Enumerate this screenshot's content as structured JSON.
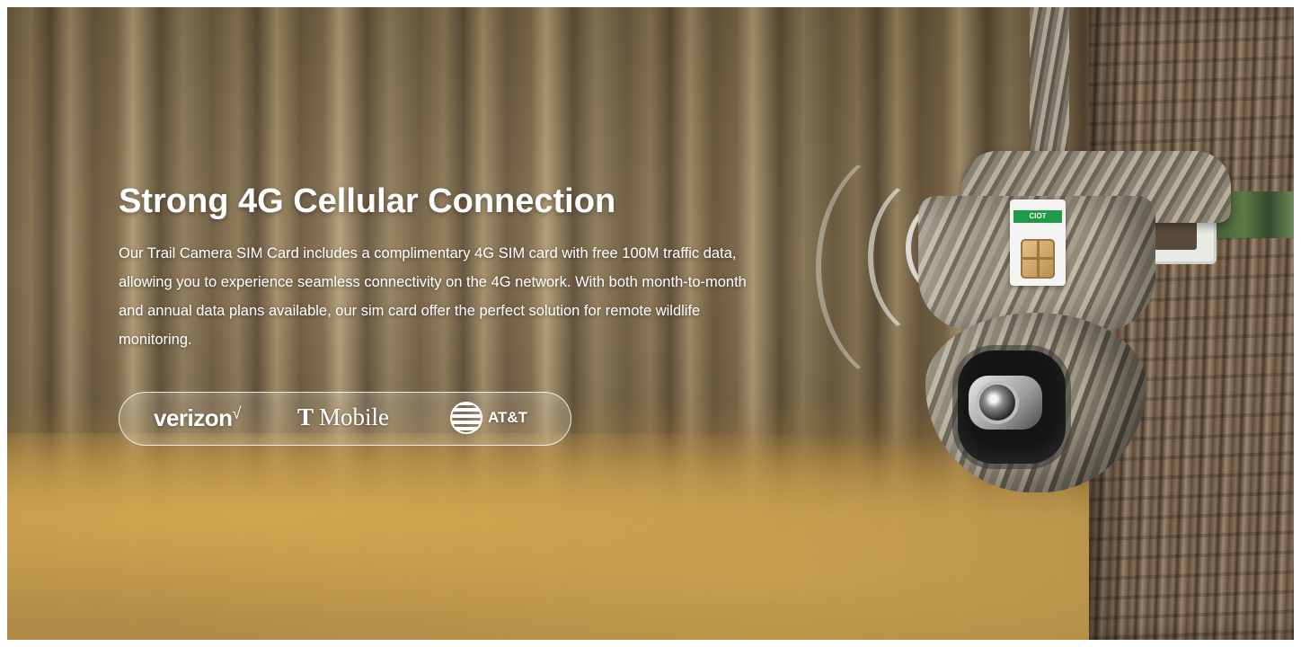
{
  "banner": {
    "headline": "Strong 4G Cellular Connection",
    "description": "Our Trail Camera SIM Card includes a complimentary 4G SIM card with free 100M traffic data, allowing you to experience seamless connectivity on the 4G network. With both month-to-month and annual data plans available, our sim card offer the perfect solution for remote wildlife monitoring.",
    "carriers": [
      {
        "name": "verizon",
        "mark": "√"
      },
      {
        "name": "Mobile",
        "mark": "T"
      },
      {
        "name": "AT&T",
        "icon": "att-globe-icon"
      }
    ],
    "sim_label": "CIOT"
  },
  "colors": {
    "text": "#ffffff",
    "sim_band": "#1f9a48"
  }
}
